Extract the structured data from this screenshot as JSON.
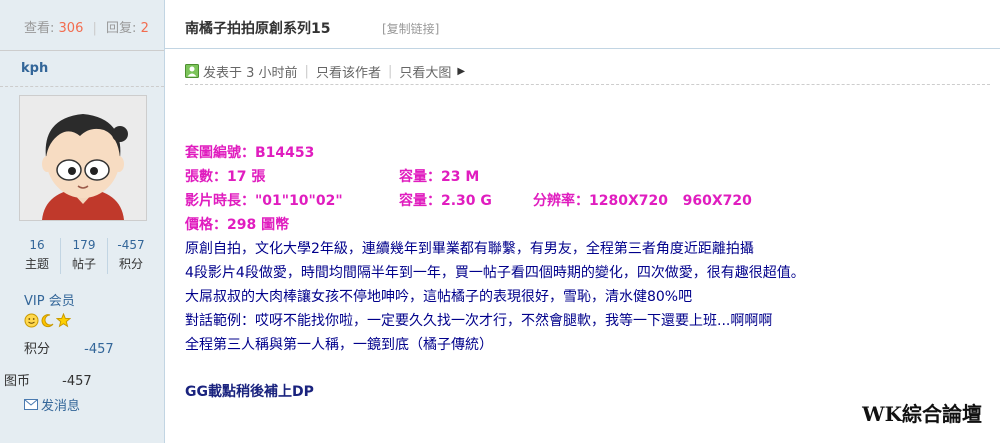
{
  "sidebar": {
    "views_label": "查看:",
    "views": "306",
    "replies_label": "回复:",
    "replies": "2",
    "username": "kph",
    "stats": [
      {
        "value": "16",
        "label": "主题"
      },
      {
        "value": "179",
        "label": "帖子"
      },
      {
        "value": "-457",
        "label": "积分"
      }
    ],
    "group": "VIP 会员",
    "medals": [
      "smile-medal-icon",
      "moon-medal-icon",
      "star-medal-icon"
    ],
    "points_label": "积分",
    "points_value": "-457",
    "coins_label": "图币",
    "coins_value": "-457",
    "send_message": "发消息"
  },
  "post": {
    "title": "南橘子拍拍原創系列15",
    "copy_link": "[复制链接]",
    "posted": "发表于 3 小时前",
    "author_only": "只看该作者",
    "large_image": "只看大图",
    "info": {
      "set_number": "套圖編號：B14453",
      "count": "張數：17 張",
      "capacity1": "容量：23 M",
      "duration": "影片時長：\"01\"10\"02\"",
      "capacity2": "容量：2.30 G",
      "resolution": "分辨率：1280X720   960X720",
      "price": "價格：298 圖幣"
    },
    "paragraphs": [
      "原創自拍，文化大學2年級，連續幾年到畢業都有聯繫，有男友，全程第三者角度近距離拍攝",
      "4段影片4段做愛，時間均間隔半年到一年，買一帖子看四個時期的變化，四次做愛，很有趣很超值。",
      "大屌叔叔的大肉棒讓女孩不停地呻吟，這帖橘子的表現很好，雪恥，清水健80%吧",
      "對話範例：哎呀不能找你啦，一定要久久找一次才行，不然會腿軟，我等一下還要上班...啊啊啊",
      "全程第三人稱與第一人稱，一鏡到底（橘子傳統）"
    ],
    "closing": "GG載點稍後補上DP",
    "watermark": "WK綜合論壇"
  },
  "colors": {
    "sidebar_bg": "#e5edf2",
    "info_magenta": "#e01dbf",
    "body_navy": "#00008b",
    "link_blue": "#336699"
  }
}
